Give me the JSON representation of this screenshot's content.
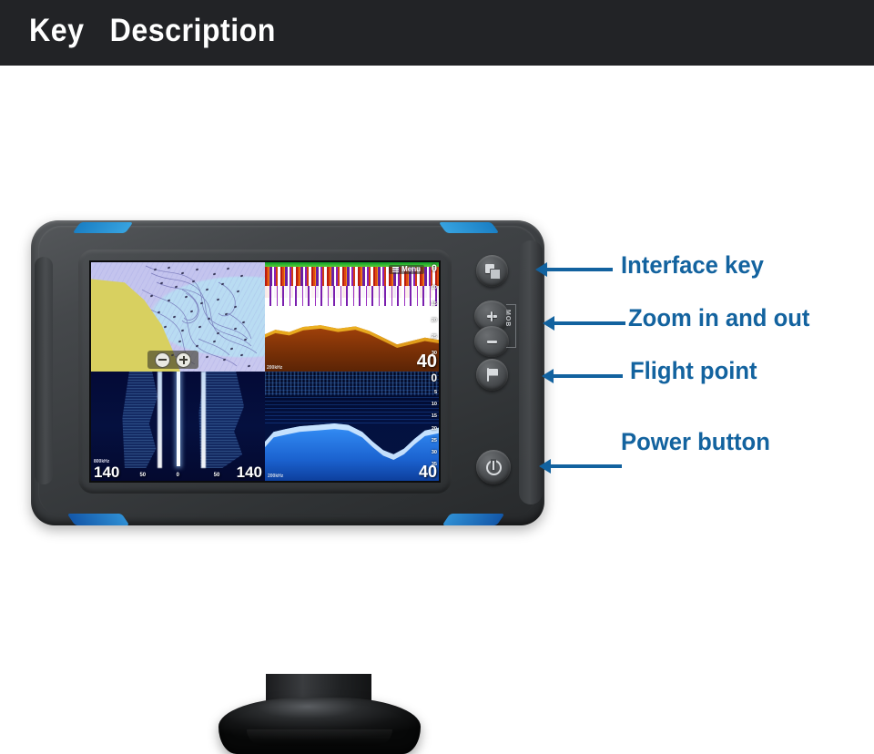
{
  "header": {
    "title": "Key   Description",
    "background_color": "#222326",
    "text_color": "#ffffff"
  },
  "theme": {
    "callout_blue": "#13639f",
    "accent_blue": "#1f8ad0",
    "page_background": "#ffffff"
  },
  "callouts": [
    {
      "label": "Interface key",
      "target": "interface-key-button"
    },
    {
      "label": "Zoom in and out",
      "target": "zoom-buttons"
    },
    {
      "label": "Flight point",
      "target": "flight-point-button"
    },
    {
      "label": "Power button",
      "target": "power-button"
    }
  ],
  "device": {
    "type": "marine-chartplotter-fishfinder",
    "buttons": {
      "interface": {
        "icon": "windows-squares-icon",
        "name": "Interface key"
      },
      "zoom_in": {
        "icon": "plus-icon",
        "name": "Zoom in"
      },
      "zoom_out": {
        "icon": "minus-icon",
        "name": "Zoom out"
      },
      "mob_label": "MOB",
      "flight_point": {
        "icon": "flag-icon",
        "name": "Flight point"
      },
      "power": {
        "icon": "power-icon",
        "name": "Power button"
      }
    },
    "screen": {
      "layout": "quad-split",
      "panes": {
        "chart": {
          "name": "navigation-chart",
          "zoom_out_label": "−",
          "zoom_in_label": "+"
        },
        "sonar_traditional": {
          "name": "traditional-sonar",
          "menu_label": "Menu",
          "frequency": "200kHz",
          "depth_reading": "40",
          "scale": [
            "0",
            "10",
            "15",
            "20",
            "25",
            "30"
          ]
        },
        "side_scan": {
          "name": "side-scan-sonar",
          "frequency": "800kHz",
          "range_left": "140",
          "range_right": "140",
          "ticks": [
            "50",
            "0",
            "50"
          ]
        },
        "down_scan": {
          "name": "down-scan-sonar",
          "frequency": "200kHz",
          "depth_reading": "40",
          "scale": [
            "0",
            "5",
            "10",
            "15",
            "20",
            "25",
            "30",
            "35"
          ]
        }
      }
    }
  }
}
